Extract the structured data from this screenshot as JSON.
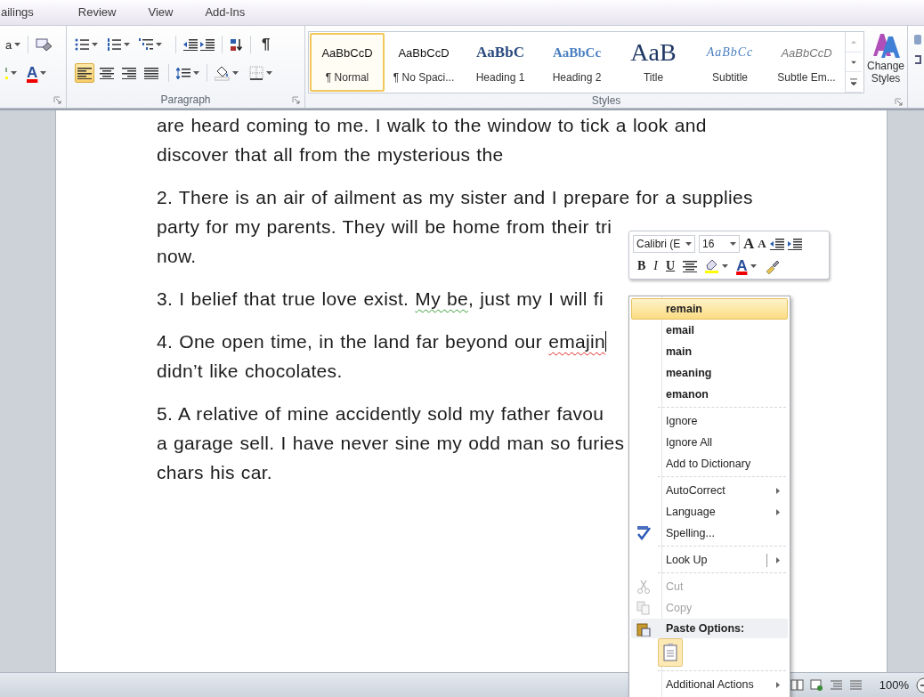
{
  "ribbon_tabs": [
    {
      "label": "ailings",
      "selected": false
    },
    {
      "label": "Review",
      "selected": false
    },
    {
      "label": "View",
      "selected": false
    },
    {
      "label": "Add-Ins",
      "selected": false
    }
  ],
  "font_group": {
    "font_field": "a",
    "font_color_glyph": "A"
  },
  "paragraph_group": {
    "label": "Paragraph",
    "pilcrow": "¶",
    "alignments": [
      {
        "selected": true
      },
      {
        "selected": false
      },
      {
        "selected": false
      },
      {
        "selected": false
      }
    ]
  },
  "styles_group": {
    "label": "Styles",
    "change_styles": "Change Styles",
    "styles": [
      {
        "kind": "normal",
        "sample": "AaBbCcD",
        "name": "¶ Normal",
        "selected": true
      },
      {
        "kind": "no-spacing",
        "sample": "AaBbCcD",
        "name": "¶ No Spaci...",
        "selected": false
      },
      {
        "kind": "heading-1",
        "sample": "AaBbC",
        "name": "Heading 1",
        "selected": false
      },
      {
        "kind": "heading-2",
        "sample": "AaBbCc",
        "name": "Heading 2",
        "selected": false
      },
      {
        "kind": "title",
        "sample": "AaB",
        "name": "Title",
        "selected": false
      },
      {
        "kind": "subtitle",
        "sample": "AaBbCc",
        "name": "Subtitle",
        "selected": false
      },
      {
        "kind": "subtle-emphasis",
        "sample": "AaBbCcD",
        "name": "Subtle Em...",
        "selected": false
      }
    ]
  },
  "document": {
    "paragraphs": [
      {
        "lines": [
          {
            "segments": [
              {
                "text": "are heard coming to me. I walk to the window to tick a look and"
              }
            ]
          },
          {
            "segments": [
              {
                "text": "discover that all from the mysterious the"
              }
            ]
          }
        ]
      },
      {
        "lines": [
          {
            "segments": [
              {
                "text": "2. There is an air of ailment as my sister and I prepare for a supplies"
              }
            ]
          },
          {
            "segments": [
              {
                "text": "party for my parents. They will be home from their tri"
              }
            ]
          },
          {
            "segments": [
              {
                "text": "now."
              }
            ]
          }
        ]
      },
      {
        "lines": [
          {
            "segments": [
              {
                "text": "3. I belief that true love exist. "
              },
              {
                "text": "My be",
                "grammar_error": true
              },
              {
                "text": ", just my I will fi"
              }
            ]
          }
        ]
      },
      {
        "lines": [
          {
            "segments": [
              {
                "text": "4. One open time, in the land far beyond our "
              },
              {
                "text": "emajin",
                "spelling_error": true,
                "caret": true
              }
            ]
          },
          {
            "segments": [
              {
                "text": "didn’t like chocolates."
              }
            ]
          }
        ]
      },
      {
        "lines": [
          {
            "segments": [
              {
                "text": "5. A relative of mine accidently sold my father favou"
              }
            ]
          },
          {
            "segments": [
              {
                "text": "a garage sell. I have never sine my odd man so furies"
              }
            ]
          },
          {
            "segments": [
              {
                "text": "chars his car."
              }
            ]
          }
        ]
      }
    ]
  },
  "mini_toolbar": {
    "font": "Calibri (E",
    "size": "16",
    "grow_glyph": "A",
    "shrink_glyph": "A",
    "bold": "B",
    "italic": "I",
    "underline": "U",
    "font_color_glyph": "A"
  },
  "context_menu": {
    "items": [
      {
        "kind": "suggestion",
        "label": "remain",
        "selected": true,
        "disabled": false,
        "submenu": false
      },
      {
        "kind": "suggestion",
        "label": "email",
        "selected": false,
        "disabled": false,
        "submenu": false
      },
      {
        "kind": "suggestion",
        "label": "main",
        "selected": false,
        "disabled": false,
        "submenu": false
      },
      {
        "kind": "suggestion",
        "label": "meaning",
        "selected": false,
        "disabled": false,
        "submenu": false
      },
      {
        "kind": "suggestion",
        "label": "emanon",
        "selected": false,
        "disabled": false,
        "submenu": false
      },
      {
        "kind": "command",
        "label": "Ignore",
        "selected": false,
        "disabled": false,
        "submenu": false,
        "separator_before": true
      },
      {
        "kind": "command",
        "label": "Ignore All",
        "selected": false,
        "disabled": false,
        "submenu": false
      },
      {
        "kind": "command",
        "label": "Add to Dictionary",
        "selected": false,
        "disabled": false,
        "submenu": false
      },
      {
        "kind": "command",
        "label": "AutoCorrect",
        "selected": false,
        "disabled": false,
        "submenu": true,
        "separator_before": true
      },
      {
        "kind": "command",
        "label": "Language",
        "selected": false,
        "disabled": false,
        "submenu": true
      },
      {
        "kind": "command",
        "label": "Spelling...",
        "selected": false,
        "disabled": false,
        "submenu": false
      },
      {
        "kind": "split",
        "label": "Look Up",
        "selected": false,
        "disabled": false,
        "submenu": true,
        "separator_before": true
      },
      {
        "kind": "command",
        "label": "Cut",
        "selected": false,
        "disabled": true,
        "submenu": false,
        "separator_before": true
      },
      {
        "kind": "command",
        "label": "Copy",
        "selected": false,
        "disabled": true,
        "submenu": false
      },
      {
        "kind": "header",
        "label": "Paste Options:",
        "selected": false,
        "disabled": false,
        "submenu": false
      },
      {
        "kind": "paste-button",
        "selected": false,
        "disabled": false
      },
      {
        "kind": "command",
        "label": "Additional Actions",
        "selected": false,
        "disabled": false,
        "submenu": true,
        "separator_before": true
      }
    ]
  },
  "status_bar": {
    "zoom": "100%"
  }
}
